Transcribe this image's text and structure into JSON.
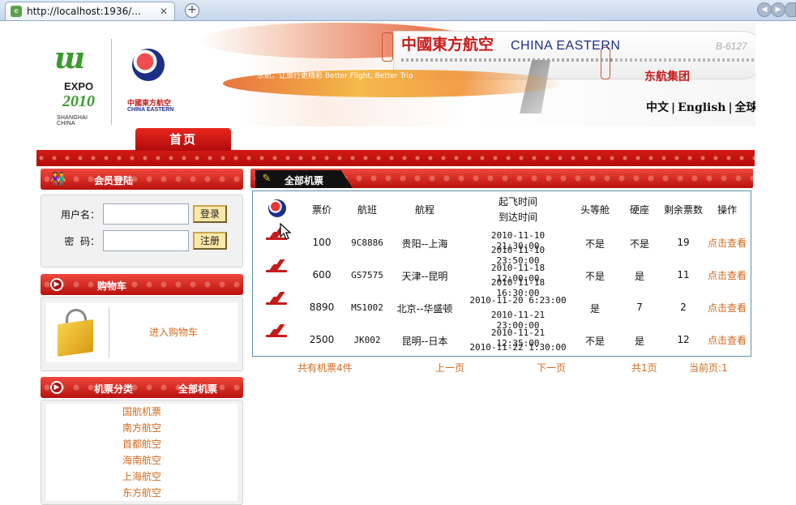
{
  "browser": {
    "tab_title": "http://localhost:1936/...",
    "close_glyph": "✕",
    "newtab_glyph": "+"
  },
  "header": {
    "expo_word": "EXPO",
    "expo_year": "2010",
    "expo_sub": "SHANGHAI CHINA",
    "airline_cn": "中國東方航空",
    "airline_en": "CHINA EASTERN",
    "plane_cn": "中國東方航空",
    "plane_en": "CHINA EASTERN",
    "plane_reg": "B-6127",
    "slogan": "东航，让旅行更精彩 Better Flight, Better Trip",
    "group_name": "东航集团",
    "lang_items": [
      "中文",
      "English",
      "全球站"
    ]
  },
  "nav": {
    "home_label": "首页"
  },
  "login": {
    "title": "会员登陆",
    "username_label": "用户名：",
    "password_label": "密  码：",
    "login_button": "登录",
    "register_button": "注册"
  },
  "cart": {
    "title": "购物车",
    "link": "进入购物车"
  },
  "categories": {
    "title": "机票分类",
    "all_label": "全部机票",
    "items": [
      "国航机票",
      "南方航空",
      "首都航空",
      "海南航空",
      "上海航空",
      "东方航空"
    ]
  },
  "tickets": {
    "panel_title": "全部机票",
    "headers": {
      "price": "票价",
      "flight": "航班",
      "route": "航程",
      "time_line1": "起飞时间",
      "time_line2": "到达时间",
      "first_class": "头等舱",
      "hard_seat": "硬座",
      "remaining": "剩余票数",
      "action": "操作"
    },
    "rows": [
      {
        "price": "100",
        "flight": "9C8886",
        "route": "贵阳--上海",
        "depart": "2010-11-10 21:30:00",
        "arrive": "2010-11-10 23:50:00",
        "first": "不是",
        "hard": "不是",
        "remaining": "19",
        "action": "点击查看"
      },
      {
        "price": "600",
        "flight": "GS7575",
        "route": "天津--昆明",
        "depart": "2010-11-18 12:00:00",
        "arrive": "2010-11-18 16:30:00",
        "first": "不是",
        "hard": "是",
        "remaining": "11",
        "action": "点击查看"
      },
      {
        "price": "8890",
        "flight": "MS1002",
        "route": "北京--华盛顿",
        "depart": "2010-11-20 6:23:00",
        "arrive": "2010-11-21 23:00:00",
        "first": "是",
        "hard": "7",
        "remaining": "2",
        "action": "点击查看"
      },
      {
        "price": "2500",
        "flight": "JK002",
        "route": "昆明--日本",
        "depart": "2010-11-21 12:35:00",
        "arrive": "2010-11-22 1:30:00",
        "first": "不是",
        "hard": "是",
        "remaining": "12",
        "action": "点击查看"
      }
    ],
    "pager": {
      "total": "共有机票4件",
      "prev": "上一页",
      "next": "下一页",
      "pages": "共1页",
      "current": "当前页:1"
    }
  },
  "colors": {
    "brand_red": "#c51e1e",
    "link_orange": "#d26a1e",
    "table_border": "#5f8fae"
  }
}
